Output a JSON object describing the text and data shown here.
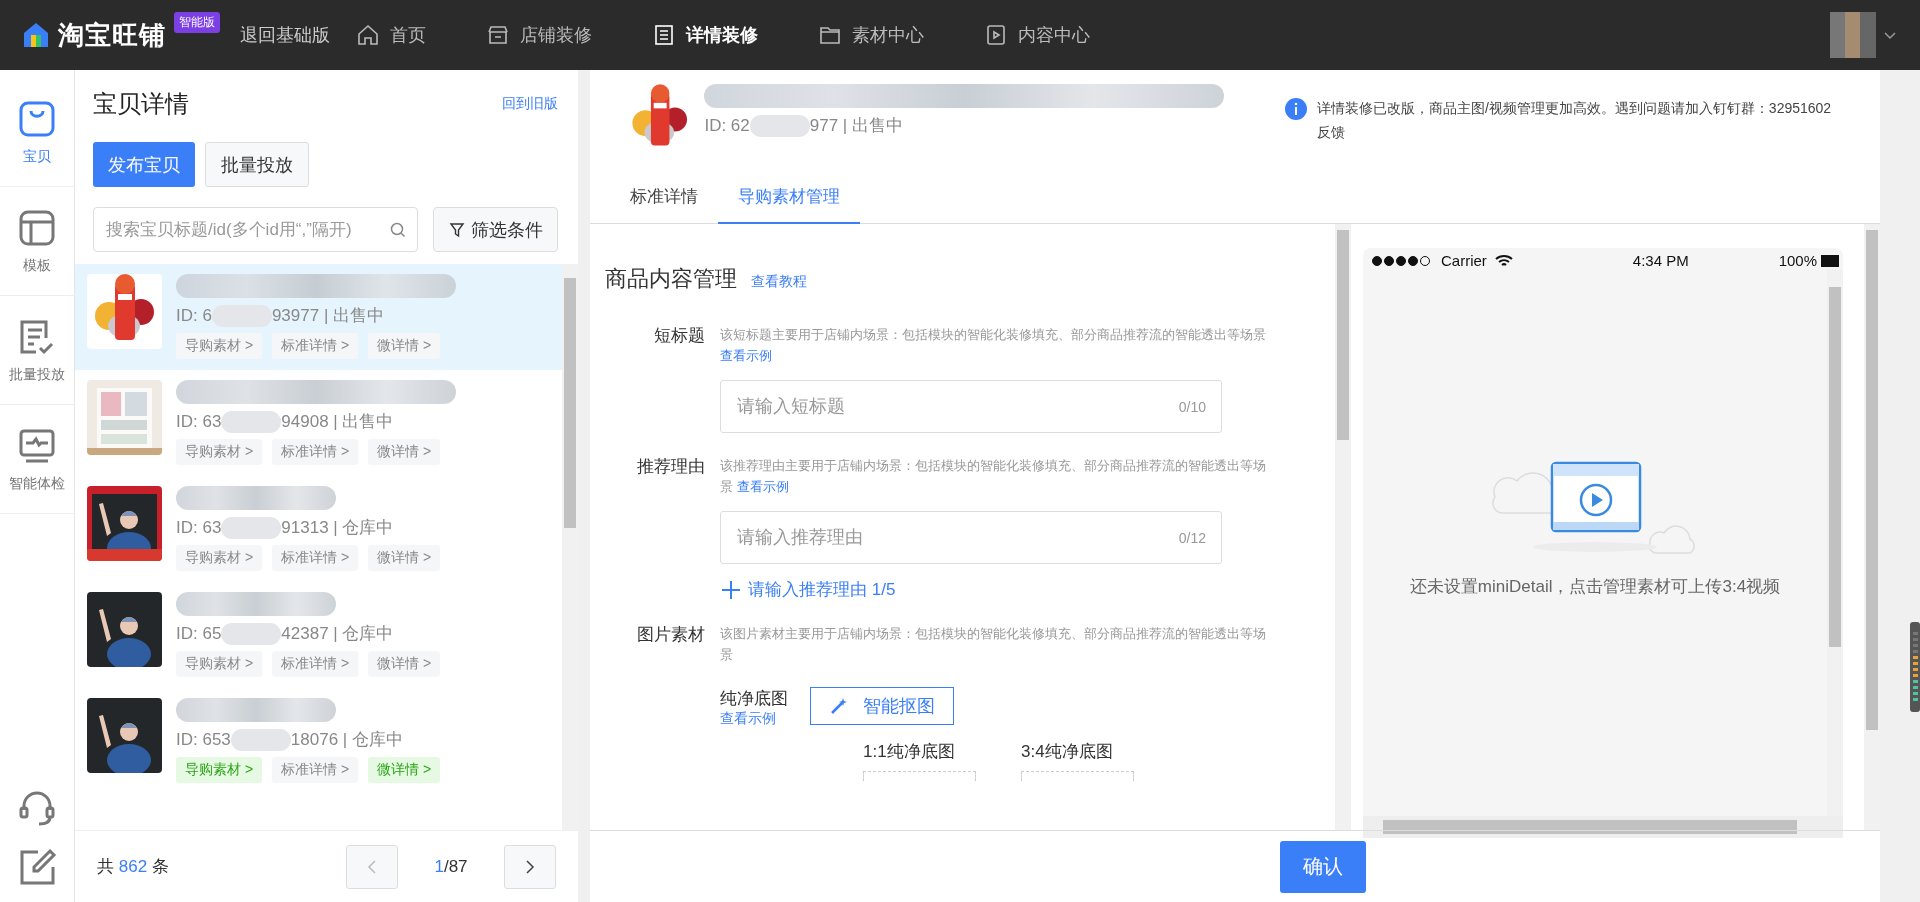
{
  "topbar": {
    "logo_text": "淘宝旺铺",
    "edition_badge": "智能版",
    "back_link": "退回基础版",
    "nav": [
      {
        "label": "首页",
        "selected": false
      },
      {
        "label": "店铺装修",
        "selected": false
      },
      {
        "label": "详情装修",
        "selected": true
      },
      {
        "label": "素材中心",
        "selected": false
      },
      {
        "label": "内容中心",
        "selected": false
      }
    ]
  },
  "rail": {
    "items": [
      {
        "label": "宝贝",
        "selected": true
      },
      {
        "label": "模板",
        "selected": false
      },
      {
        "label": "批量投放",
        "selected": false
      },
      {
        "label": "智能体检",
        "selected": false
      }
    ]
  },
  "list_panel": {
    "title": "宝贝详情",
    "old_version_link": "回到旧版",
    "buttons": [
      {
        "label": "发布宝贝",
        "primary": true
      },
      {
        "label": "批量投放",
        "primary": false
      }
    ],
    "search": {
      "placeholder": "搜索宝贝标题/id(多个id用“,”隔开)"
    },
    "filter_button": "筛选条件",
    "items": [
      {
        "id_start": "ID: 6",
        "id_end": "93977 | 出售中",
        "selected": true,
        "tags": [
          {
            "label": "导购素材 >",
            "done": false
          },
          {
            "label": "标准详情 >",
            "done": false
          },
          {
            "label": "微详情 >",
            "done": false
          }
        ]
      },
      {
        "id_start": "ID: 63",
        "id_end": "94908 | 出售中",
        "selected": false,
        "tags": [
          {
            "label": "导购素材 >",
            "done": false
          },
          {
            "label": "标准详情 >",
            "done": false
          },
          {
            "label": "微详情 >",
            "done": false
          }
        ]
      },
      {
        "id_start": "ID: 63",
        "id_end": "91313 | 仓库中",
        "selected": false,
        "tags": [
          {
            "label": "导购素材 >",
            "done": false
          },
          {
            "label": "标准详情 >",
            "done": false
          },
          {
            "label": "微详情 >",
            "done": false
          }
        ]
      },
      {
        "id_start": "ID: 65",
        "id_end": "42387 | 仓库中",
        "selected": false,
        "tags": [
          {
            "label": "导购素材 >",
            "done": false
          },
          {
            "label": "标准详情 >",
            "done": false
          },
          {
            "label": "微详情 >",
            "done": false
          }
        ]
      },
      {
        "id_start": "ID: 653",
        "id_end": "18076 | 仓库中",
        "selected": false,
        "tags": [
          {
            "label": "导购素材 >",
            "done": true
          },
          {
            "label": "标准详情 >",
            "done": false
          },
          {
            "label": "微详情 >",
            "done": true
          }
        ]
      }
    ],
    "pagination": {
      "total_prefix": "共",
      "total": "862",
      "total_suffix": "条",
      "page": "1",
      "pages": "/87",
      "prev_disabled": true,
      "next_disabled": false
    }
  },
  "product_header": {
    "id_start": "ID: 62",
    "id_end": "977 | 出售中",
    "notice": "详情装修已改版，商品主图/视频管理更加高效。遇到问题请加入钉钉群：32951602",
    "feedback": "反馈"
  },
  "tabs": [
    {
      "label": "标准详情",
      "selected": false
    },
    {
      "label": "导购素材管理",
      "selected": true
    }
  ],
  "form": {
    "title": "商品内容管理",
    "tutorial_link": "查看教程",
    "fields": [
      {
        "label": "短标题",
        "hint": "该短标题主要用于店铺内场景：包括模块的智能化装修填充、部分商品推荐流的智能透出等场景",
        "example_link": "查看示例",
        "placeholder": "请输入短标题",
        "counter": "0/10"
      },
      {
        "label": "推荐理由",
        "hint": "该推荐理由主要用于店铺内场景：包括模块的智能化装修填充、部分商品推荐流的智能透出等场景",
        "example_link": "查看示例",
        "placeholder": "请输入推荐理由",
        "counter": "0/12",
        "add_link": "请输入推荐理由 1/5"
      }
    ],
    "images": {
      "label": "图片素材",
      "hint": "该图片素材主要用于店铺内场景：包括模块的智能化装修填充、部分商品推荐流的智能透出等场景",
      "sub_label": "纯净底图",
      "sub_link": "查看示例",
      "cutout_button": "智能抠图",
      "slots": [
        "1:1纯净底图",
        "3:4纯净底图"
      ]
    },
    "confirm": "确认"
  },
  "preview": {
    "carrier": "Carrier",
    "time": "4:34 PM",
    "battery": "100%",
    "empty_text": "还未设置miniDetail，点击管理素材可上传3:4视频"
  }
}
